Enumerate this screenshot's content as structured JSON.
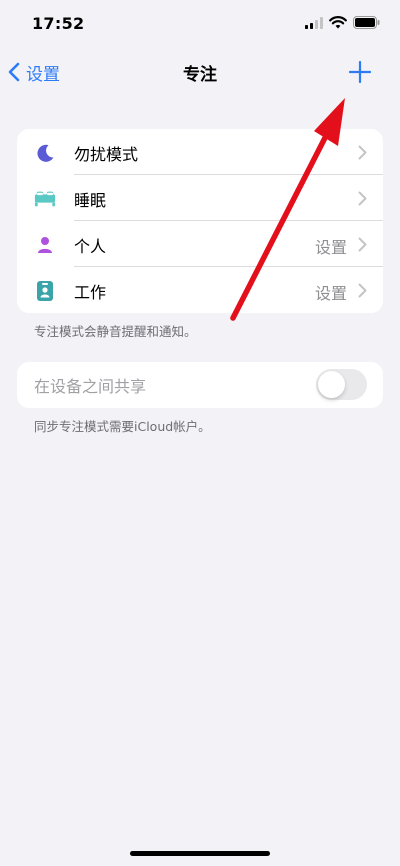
{
  "status_bar": {
    "time": "17:52"
  },
  "nav": {
    "back_label": "设置",
    "title": "专注"
  },
  "focus_list": [
    {
      "label": "勿扰模式",
      "detail": "",
      "icon": "moon-icon",
      "color": "#5b5bd6"
    },
    {
      "label": "睡眠",
      "detail": "",
      "icon": "bed-icon",
      "color": "#5ac8c4"
    },
    {
      "label": "个人",
      "detail": "设置",
      "icon": "person-icon",
      "color": "#af52de"
    },
    {
      "label": "工作",
      "detail": "设置",
      "icon": "id-badge-icon",
      "color": "#3aa5a8"
    }
  ],
  "focus_footnote": "专注模式会静音提醒和通知。",
  "share": {
    "label": "在设备之间共享",
    "enabled": false,
    "footnote": "同步专注模式需要iCloud帐户。"
  },
  "colors": {
    "accent": "#2d7cf6",
    "background": "#f2f2f7",
    "annotation_arrow": "#e3101c"
  }
}
